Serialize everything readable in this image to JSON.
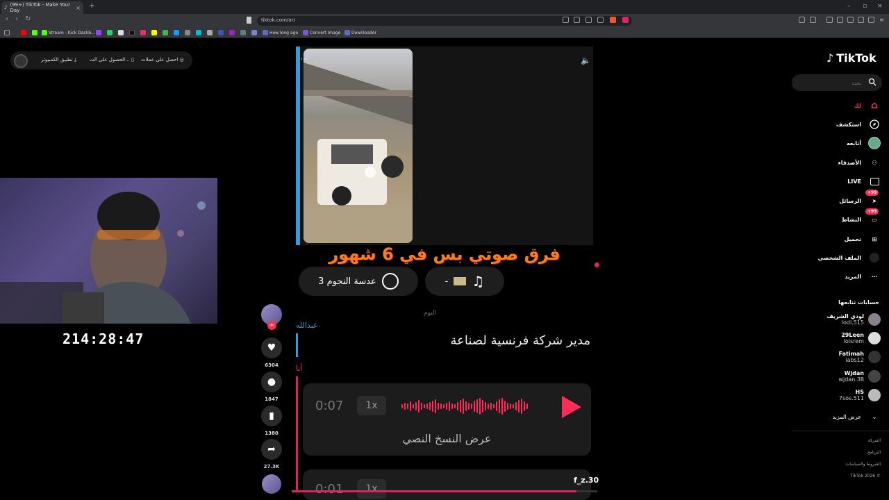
{
  "browser": {
    "tab_title": "(99+) TikTok - Make Your Day",
    "url": "tiktok.com/ar/",
    "bookmarks": [
      "Stream - Kick Dashb...",
      "How long ago",
      "Convert Image",
      "Downloader"
    ]
  },
  "topbar": {
    "get_coins": "احصل على عملات",
    "get_app": "الحصول على الت...",
    "desktop_app": "تطبيق الكمبيوتر"
  },
  "stream": {
    "timer": "214:28:47"
  },
  "video": {
    "caption_text": "فرق صوتي بس في 6 شهور",
    "pill_left": "عدسة النجوم 3",
    "pill_right": "-"
  },
  "chat": {
    "day_label": "اليوم",
    "sender": "عبدالله",
    "message": "مدير شركة فرنسية لصناعة",
    "me_label": "أنا",
    "voice1": {
      "time": "0:07",
      "speed": "1x",
      "transcript": "عرض النسخ النصي"
    },
    "voice2": {
      "time": "0:01",
      "speed": "1x"
    },
    "handle": "f_z.30"
  },
  "actions": {
    "likes": "6304",
    "comments": "1847",
    "saves": "1380",
    "shares": "27.3K"
  },
  "sidebar": {
    "logo": "TikTok",
    "search_placeholder": "بحث",
    "nav": [
      {
        "label": "لك",
        "icon": "home-icon"
      },
      {
        "label": "استكشف",
        "icon": "compass-icon"
      },
      {
        "label": "أتابعه",
        "icon": "following-icon"
      },
      {
        "label": "الأصدقاء",
        "icon": "friends-icon"
      },
      {
        "label": "LIVE",
        "icon": "live-icon"
      },
      {
        "label": "الرسائل",
        "icon": "messages-icon",
        "badge": "+99"
      },
      {
        "label": "النشاط",
        "icon": "activity-icon",
        "badge": "+99"
      },
      {
        "label": "تحميل",
        "icon": "upload-icon"
      },
      {
        "label": "الملف الشخصي",
        "icon": "profile-icon"
      },
      {
        "label": "المزيد",
        "icon": "more-icon"
      }
    ],
    "following_header": "حسابات تتابعها",
    "accounts": [
      {
        "name": "لودي الشريف",
        "username": "lodi.515"
      },
      {
        "name": "29Leen",
        "username": "lolsrem"
      },
      {
        "name": "Fatimah",
        "username": "iabs12"
      },
      {
        "name": "Wjdan",
        "username": "wjdan.38"
      },
      {
        "name": "HS",
        "username": "7sos.511"
      }
    ],
    "see_more": "عرض المزيد",
    "footer": [
      "الشركة",
      "البرنامج",
      "الشروط والسياسات",
      "TikTok 2026 ©"
    ]
  },
  "colors": {
    "accent": "#fe2c55",
    "link_blue": "#3a9ad9",
    "caption_orange": "#ff7a20"
  }
}
